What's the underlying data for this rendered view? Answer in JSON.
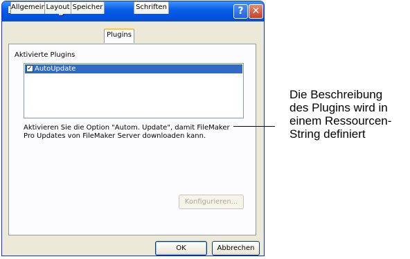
{
  "window": {
    "title": "Einstellungen",
    "help_glyph": "?",
    "close_glyph": "✕"
  },
  "tabs": [
    {
      "label": "Allgemein",
      "active": false
    },
    {
      "label": "Layout",
      "active": false
    },
    {
      "label": "Speicher",
      "active": false
    },
    {
      "label": "Plugins",
      "active": true
    },
    {
      "label": "Schriften",
      "active": false
    }
  ],
  "plugins": {
    "section_label": "Aktivierte Plugins",
    "items": [
      {
        "label": "AutoUpdate",
        "checked": true,
        "check_glyph": "✓",
        "selected": true
      }
    ],
    "description": "Aktivieren Sie die Option \"Autom. Update\", damit FileMaker Pro Updates von FileMaker Server downloaden kann.",
    "configure_button": "Konfigurieren..."
  },
  "footer": {
    "ok_button": "OK",
    "cancel_button": "Abbrechen"
  },
  "annotation": {
    "lines": [
      "Die Beschreibung",
      "des Plugins wird in",
      "einem Ressourcen-",
      "String definiert"
    ]
  },
  "colors": {
    "titlebar": "#0054e3",
    "selection": "#316ac5",
    "active_tab_accent": "#ffc83c",
    "dialog_bg": "#ece9d8"
  }
}
